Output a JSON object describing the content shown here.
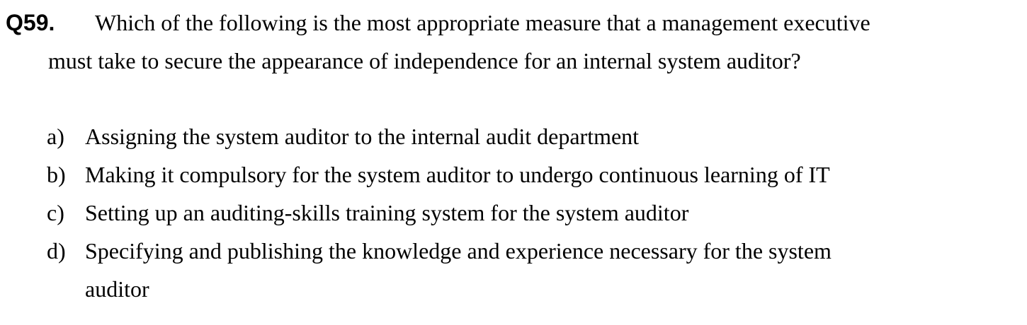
{
  "question": {
    "number": "Q59.",
    "text_line_1": "Which of the following is the most appropriate measure that a management executive",
    "text_line_2": "must take to secure the appearance of independence for an internal system auditor?"
  },
  "options": [
    {
      "letter": "a)",
      "text": "Assigning the system auditor to the internal audit department"
    },
    {
      "letter": "b)",
      "text": "Making it compulsory for the system auditor to undergo continuous learning of IT"
    },
    {
      "letter": "c)",
      "text": "Setting up an auditing-skills training system for the system auditor"
    },
    {
      "letter": "d)",
      "text": "Specifying and publishing the knowledge and experience necessary for the system",
      "text_cont": "auditor"
    }
  ]
}
